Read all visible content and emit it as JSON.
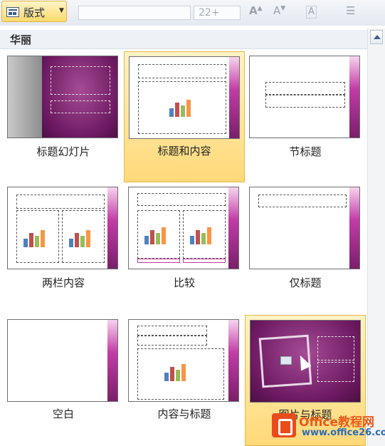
{
  "ribbon": {
    "layout_button_label": "版式",
    "font_size_value": "22+"
  },
  "gallery": {
    "section_title": "华丽",
    "layouts": [
      {
        "label": "标题幻灯片",
        "selected": false
      },
      {
        "label": "标题和内容",
        "selected": true
      },
      {
        "label": "节标题",
        "selected": false
      },
      {
        "label": "两栏内容",
        "selected": false
      },
      {
        "label": "比较",
        "selected": false
      },
      {
        "label": "仅标题",
        "selected": false
      },
      {
        "label": "空白",
        "selected": false
      },
      {
        "label": "内容与标题",
        "selected": false
      },
      {
        "label": "图片与标题",
        "selected": true
      }
    ]
  },
  "watermark": {
    "brand": "Office教程网",
    "url": "www.office26.com"
  },
  "colors": {
    "accent_purple": "#8e2a7f",
    "selection_yellow": "#ffd978",
    "watermark_orange": "#e85b1a"
  }
}
